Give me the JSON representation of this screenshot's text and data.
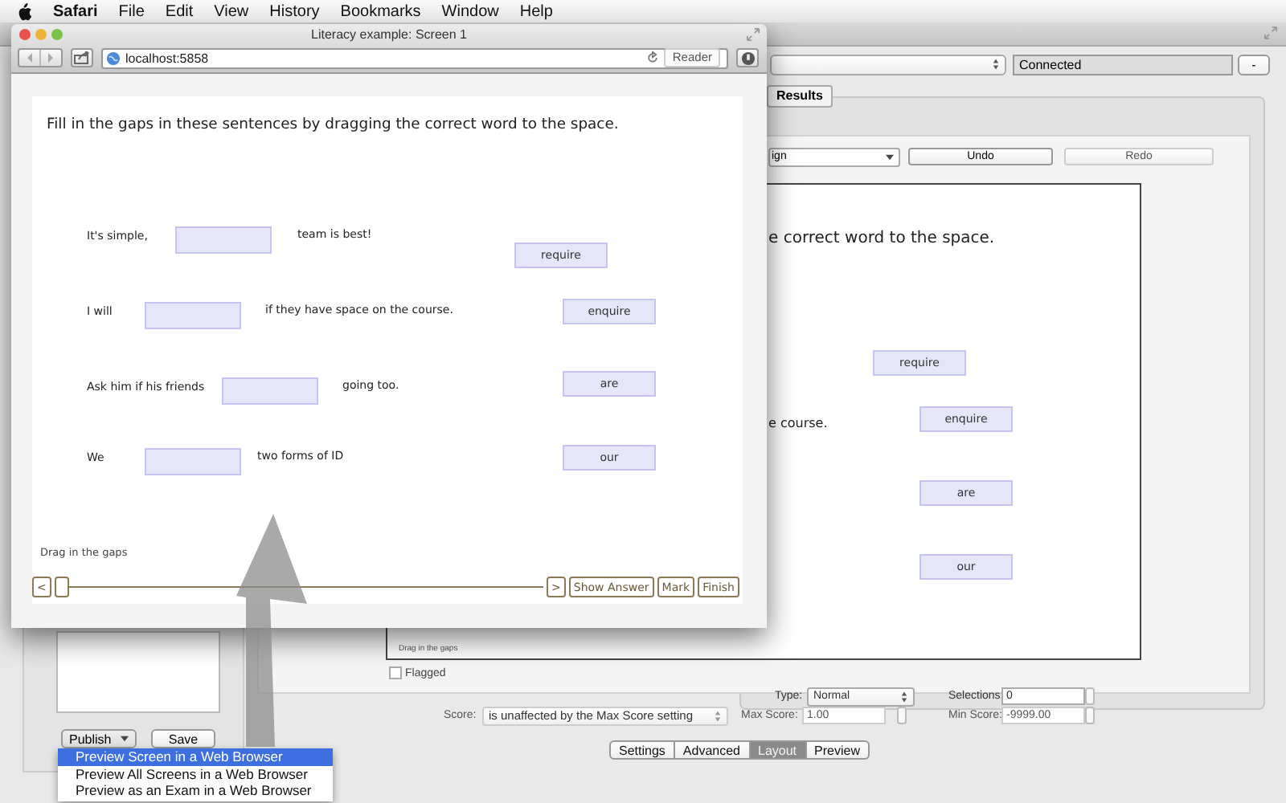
{
  "menubar": {
    "app": "Safari",
    "items": [
      "File",
      "Edit",
      "View",
      "History",
      "Bookmarks",
      "Window",
      "Help"
    ]
  },
  "editor": {
    "status": "Connected",
    "minus_button": "-",
    "tab": "Results",
    "mode_select": "ign",
    "undo": {
      "label": "Undo",
      "disabled": false
    },
    "redo": {
      "label": "Redo",
      "disabled": true
    },
    "preview": {
      "instruction_tail": "e correct word to the space.",
      "sentence_tail": "e course.",
      "words": [
        "require",
        "enquire",
        "are",
        "our"
      ],
      "hint": "Drag in the gaps"
    },
    "flagged": {
      "label": "Flagged",
      "checked": false
    },
    "score": {
      "label": "Score:",
      "value": "is unaffected by the Max Score setting",
      "disabled": true
    },
    "type": {
      "label": "Type:",
      "value": "Normal",
      "disabled": false
    },
    "max_score": {
      "label": "Max Score:",
      "value": "1.00",
      "disabled": true
    },
    "selections": {
      "label": "Selections:",
      "value": "0",
      "disabled": false
    },
    "min_score": {
      "label": "Min Score:",
      "value": "-9999.00",
      "disabled": true
    },
    "view_tabs": [
      {
        "label": "Settings",
        "selected": false
      },
      {
        "label": "Advanced",
        "selected": false
      },
      {
        "label": "Layout",
        "selected": true
      },
      {
        "label": "Preview",
        "selected": false
      }
    ],
    "publish": "Publish",
    "save": "Save",
    "publish_menu": [
      {
        "label": "Preview Screen in a Web Browser",
        "selected": true
      },
      {
        "label": "Preview All Screens in a Web Browser",
        "selected": false
      },
      {
        "label": "Preview as an Exam in a Web Browser",
        "selected": false
      }
    ]
  },
  "browser": {
    "title": "Literacy example: Screen 1",
    "url": "localhost:5858",
    "reader": {
      "label": "Reader",
      "disabled": true
    },
    "page": {
      "instruction": "Fill in the gaps in these sentences by dragging the correct word to the space.",
      "sentences": [
        {
          "before": "It's simple,",
          "after": "team is best!"
        },
        {
          "before": "I will",
          "after": "if they have space on the course."
        },
        {
          "before": "Ask him if his friends",
          "after": "going too."
        },
        {
          "before": "We",
          "after": "two forms of ID"
        }
      ],
      "words": [
        "require",
        "enquire",
        "are",
        "our"
      ],
      "hint": "Drag in the gaps",
      "nav": {
        "prev": "<",
        "next": ">",
        "level": 0,
        "buttons": [
          "Show Answer",
          "Mark",
          "Finish"
        ]
      }
    }
  }
}
